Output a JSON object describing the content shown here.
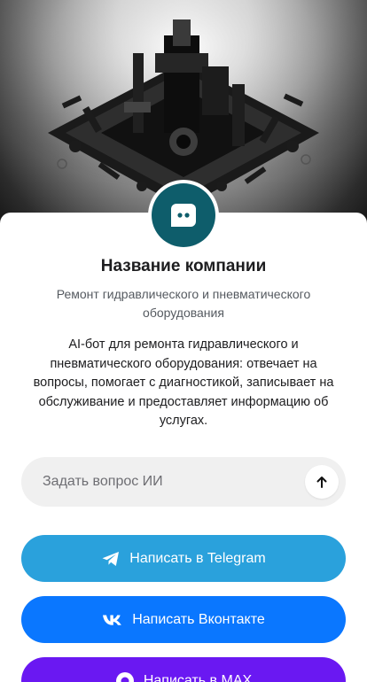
{
  "company": {
    "name": "Название компании",
    "tagline": "Ремонт гидравлического и пневматического оборудования",
    "description": "AI-бот для ремонта гидравлического и пневматического оборудования: отвечает на вопросы, помогает с диагностикой, записывает на обслуживание и предоставляет информацию об услугах."
  },
  "ask": {
    "placeholder": "Задать вопрос ИИ"
  },
  "buttons": {
    "telegram": "Написать в Telegram",
    "vk": "Написать Вконтакте",
    "max": "Написать в MAX"
  },
  "colors": {
    "logo_bg": "#0e5d6b",
    "telegram": "#2aa1dc",
    "vk": "#0a77ff",
    "max": "#6a18f2"
  },
  "icons": {
    "logo": "chat-bot-icon",
    "send": "arrow-up-icon",
    "telegram": "telegram-icon",
    "vk": "vk-icon",
    "max": "max-icon"
  }
}
